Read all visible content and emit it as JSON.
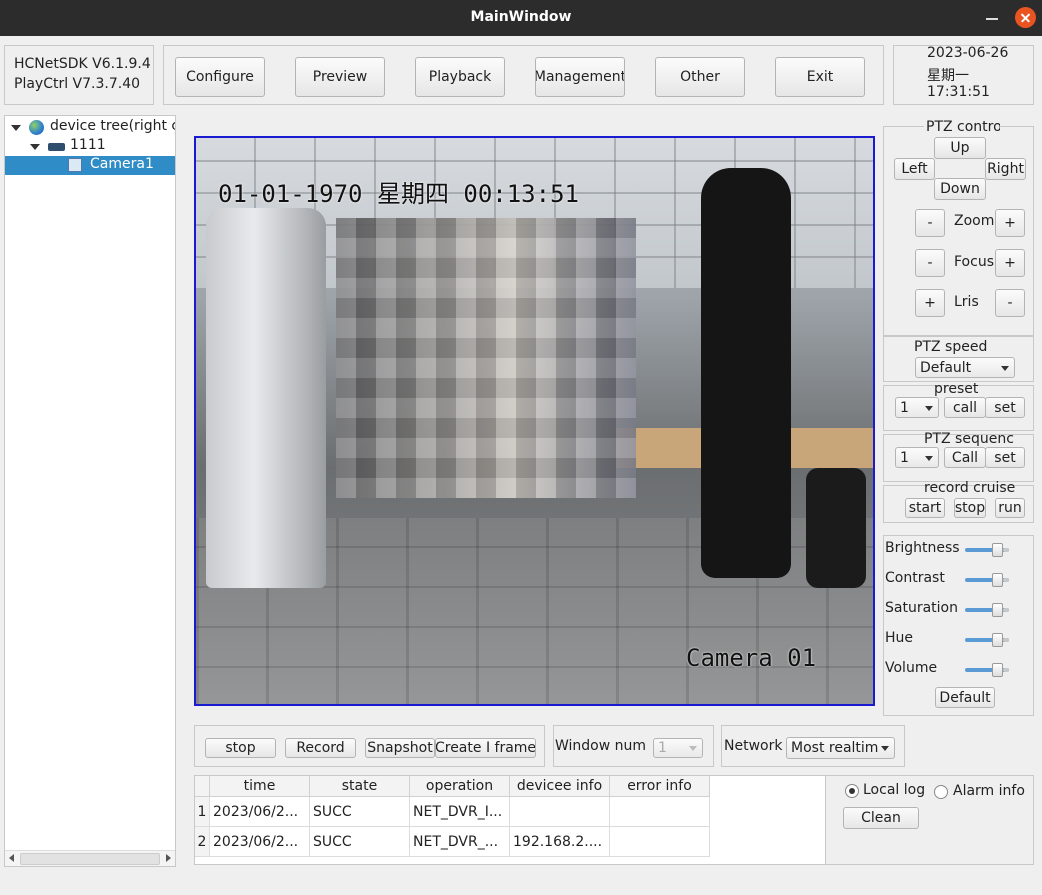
{
  "window": {
    "title": "MainWindow"
  },
  "versions": {
    "sdk": "HCNetSDK V6.1.9.4",
    "playctrl": "PlayCtrl V7.3.7.40"
  },
  "nav": [
    "Configure",
    "Preview",
    "Playback",
    "Management",
    "Other",
    "Exit"
  ],
  "clock": {
    "date": "2023-06-26",
    "weekday": "星期一",
    "time": "17:31:51"
  },
  "tree": {
    "root": "device tree(right click to add device)",
    "device": "1111",
    "camera": "Camera1"
  },
  "video": {
    "osd_timestamp": "01-01-1970 星期四 00:13:51",
    "osd_camera": "Camera 01"
  },
  "ptz": {
    "title": "PTZ control",
    "up": "Up",
    "left": "Left",
    "right": "Right",
    "down": "Down",
    "minus": "-",
    "plus": "+",
    "zoom": "Zoom",
    "focus": "Focus",
    "iris": "Lris",
    "speed_title": "PTZ speed",
    "speed_value": "Default",
    "preset_title": "preset",
    "preset_value": "1",
    "preset_call": "call",
    "preset_set": "set",
    "sequence_title": "PTZ sequence",
    "sequence_value": "1",
    "sequence_call": "Call",
    "sequence_set": "set",
    "cruise_title": "record cruise",
    "cruise_start": "start",
    "cruise_stop": "stop",
    "cruise_run": "run"
  },
  "image_params": {
    "items": [
      {
        "label": "Brightness",
        "level": 0.55
      },
      {
        "label": "Contrast",
        "level": 0.55
      },
      {
        "label": "Saturation",
        "level": 0.55
      },
      {
        "label": "Hue",
        "level": 0.55
      },
      {
        "label": "Volume",
        "level": 0.55
      }
    ],
    "default_label": "Default"
  },
  "controls": {
    "stop": "stop",
    "record": "Record",
    "snapshot": "Snapshot",
    "iframe": "Create I frame",
    "window_num_label": "Window num",
    "window_num_value": "1",
    "network_label": "Network",
    "network_value": "Most realtime"
  },
  "log": {
    "columns": [
      "time",
      "state",
      "operation",
      "devicee info",
      "error info"
    ],
    "rows": [
      {
        "n": "1",
        "time": "2023/06/2...",
        "state": "SUCC",
        "operation": "NET_DVR_I...",
        "device": "",
        "error": ""
      },
      {
        "n": "2",
        "time": "2023/06/2...",
        "state": "SUCC",
        "operation": "NET_DVR_...",
        "device": "192.168.2....",
        "error": ""
      }
    ],
    "local_log": "Local log",
    "alarm_info": "Alarm info",
    "clean": "Clean"
  },
  "colors": {
    "video_border": "#1a1ad0",
    "selection": "#308cc6",
    "close_button": "#e95420"
  }
}
